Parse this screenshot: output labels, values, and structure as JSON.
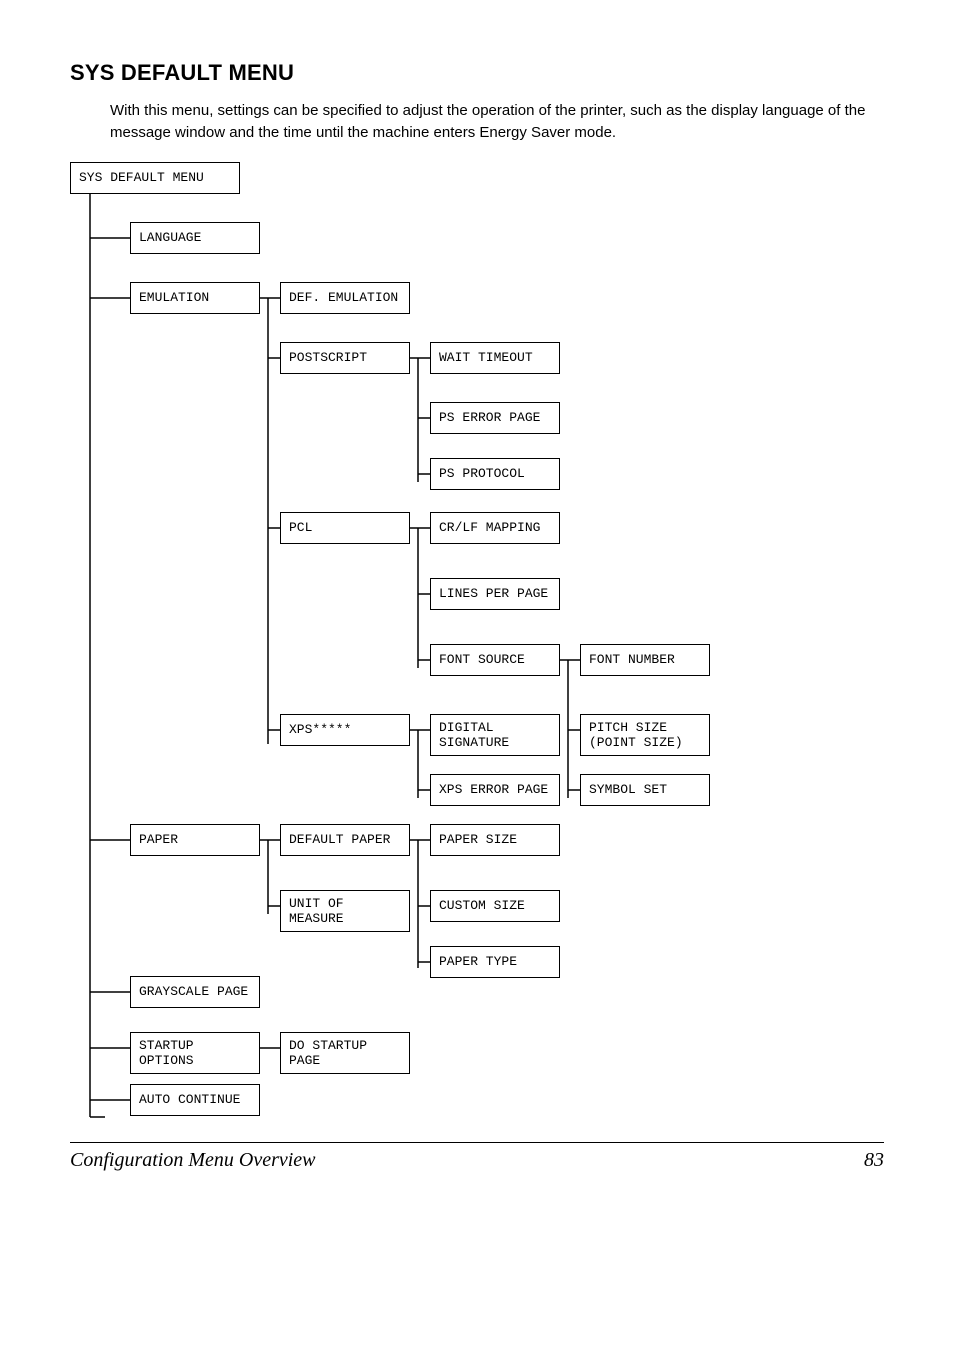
{
  "heading": "SYS DEFAULT MENU",
  "intro": "With this menu, settings can be specified to adjust the operation of the printer, such as the display language of the message window and the time until the machine enters Energy Saver mode.",
  "footer": {
    "title": "Configuration Menu Overview",
    "page": "83"
  },
  "nodes": {
    "root": "SYS DEFAULT MENU",
    "language": "LANGUAGE",
    "emulation": "EMULATION",
    "def_emulation": "DEF. EMULATION",
    "postscript": "POSTSCRIPT",
    "wait_timeout": "WAIT TIMEOUT",
    "ps_error_page": "PS ERROR PAGE",
    "ps_protocol": "PS PROTOCOL",
    "pcl": "PCL",
    "crlf": "CR/LF MAPPING",
    "lines_per_page": "LINES PER PAGE",
    "font_source": "FONT SOURCE",
    "font_number": "FONT NUMBER",
    "xps": "XPS*****",
    "digital_sig": "DIGITAL SIGNATURE",
    "pitch_size": "PITCH SIZE (POINT SIZE)",
    "xps_error_page": "XPS ERROR PAGE",
    "symbol_set": "SYMBOL SET",
    "paper": "PAPER",
    "default_paper": "DEFAULT PAPER",
    "paper_size": "PAPER SIZE",
    "unit_measure": "UNIT OF MEASURE",
    "custom_size": "CUSTOM SIZE",
    "paper_type": "PAPER TYPE",
    "grayscale": "GRAYSCALE PAGE",
    "startup_opts": "STARTUP OPTIONS",
    "do_startup": "DO STARTUP PAGE",
    "auto_continue": "AUTO CONTINUE"
  }
}
